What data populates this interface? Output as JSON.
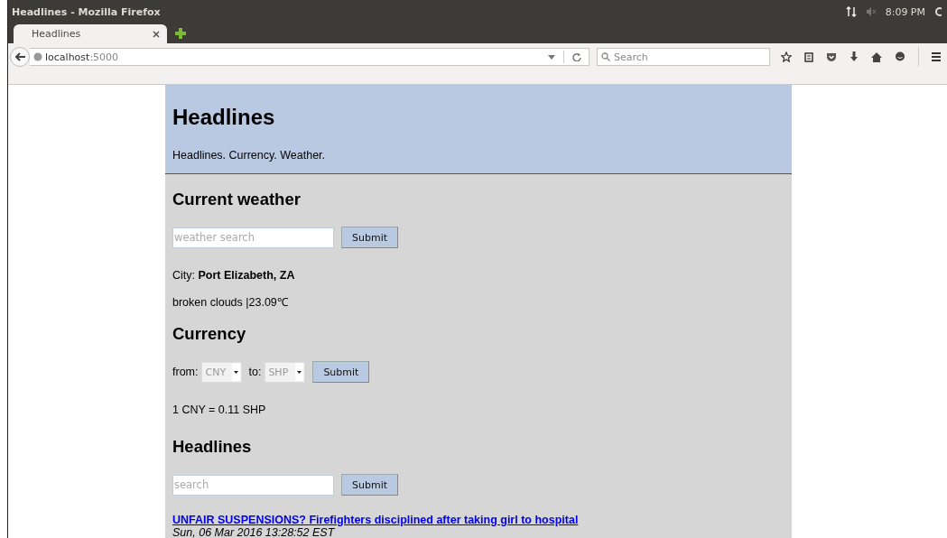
{
  "window": {
    "title": "Headlines - Mozilla Firefox"
  },
  "system_tray": {
    "clock": "8:09 PM"
  },
  "tabs": [
    {
      "label": "Headlines",
      "selected": true
    }
  ],
  "address_bar": {
    "host": "localhost",
    "port": ":5000"
  },
  "search_bar": {
    "placeholder": "Search"
  },
  "page": {
    "header": {
      "title": "Headlines",
      "tagline": "Headlines. Currency. Weather."
    },
    "weather": {
      "heading": "Current weather",
      "search": {
        "placeholder": "weather search"
      },
      "button": "Submit",
      "city": "City: **Port Elizabeth, ZA**",
      "description": "broken clouds |23.09℃"
    },
    "currency": {
      "heading": "Currency",
      "from_label": "from:",
      "from": "CNY",
      "to_label": "to:",
      "to": "SHP",
      "button": "Submit",
      "result": "1 CNY = 0.11 SHP"
    },
    "headlines": {
      "heading": "Headlines",
      "search": {
        "placeholder": "search"
      },
      "button": "Submit",
      "articles": [
        {
          "title": "UNFAIR SUSPENSIONS? Firefighters disciplined after taking girl to hospital",
          "published": "Sun, 06 Mar 2016 13:28:52 EST"
        }
      ]
    }
  }
}
